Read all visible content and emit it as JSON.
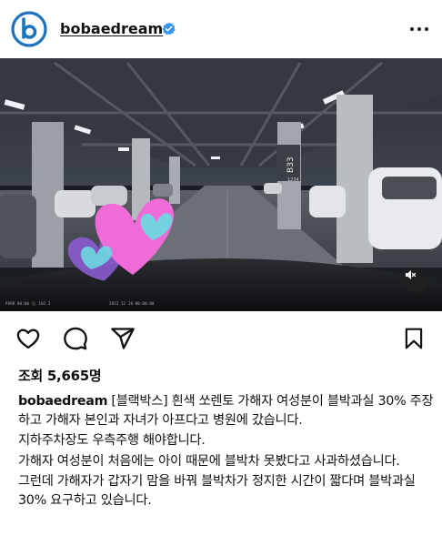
{
  "post": {
    "username": "bobaedream",
    "verified": true,
    "avatar_icon": "bobaedream-b-logo-icon",
    "more_icon": "ellipsis-horizontal-icon"
  },
  "media": {
    "description_icon": "dashcam-parking-garage-video",
    "dashcam_left": "PARK 00:00    ⬛ 102.3",
    "dashcam_right": "2022 12 18  00:00:00",
    "sticker_icon": "hearts-sticker-icon",
    "sound_icon": "speaker-muted-icon",
    "pillar_label": "B33",
    "pillar_sub": "1234"
  },
  "actions": {
    "like_icon": "heart-outline-icon",
    "comment_icon": "comment-bubble-icon",
    "share_icon": "paper-plane-icon",
    "save_icon": "bookmark-icon"
  },
  "views": "조회 5,665명",
  "caption": {
    "username": "bobaedream",
    "line1": " [블랙박스] 흰색 쏘렌토 가해자 여성분이 블박과실 30% 주장하고 가해자 본인과 자녀가 아프다고 병원에 갔습니다.",
    "line2": "지하주차장도 우측주행 해야합니다.",
    "line3": "가해자 여성분이 처음에는 아이 때문에 블박차 못봤다고 사과하셨습니다.",
    "line4": "그런데 가해자가 갑자기 맘을 바꿔 블박차가 정지한 시간이 짧다며 블박과실 30% 요구하고 있습니다."
  },
  "colors": {
    "brand_blue": "#1e73be",
    "verified_blue": "#3897f0",
    "sticker_pink": "#f06ad8",
    "sticker_teal": "#6dd8e0",
    "sticker_purple": "#8a5bd0"
  }
}
